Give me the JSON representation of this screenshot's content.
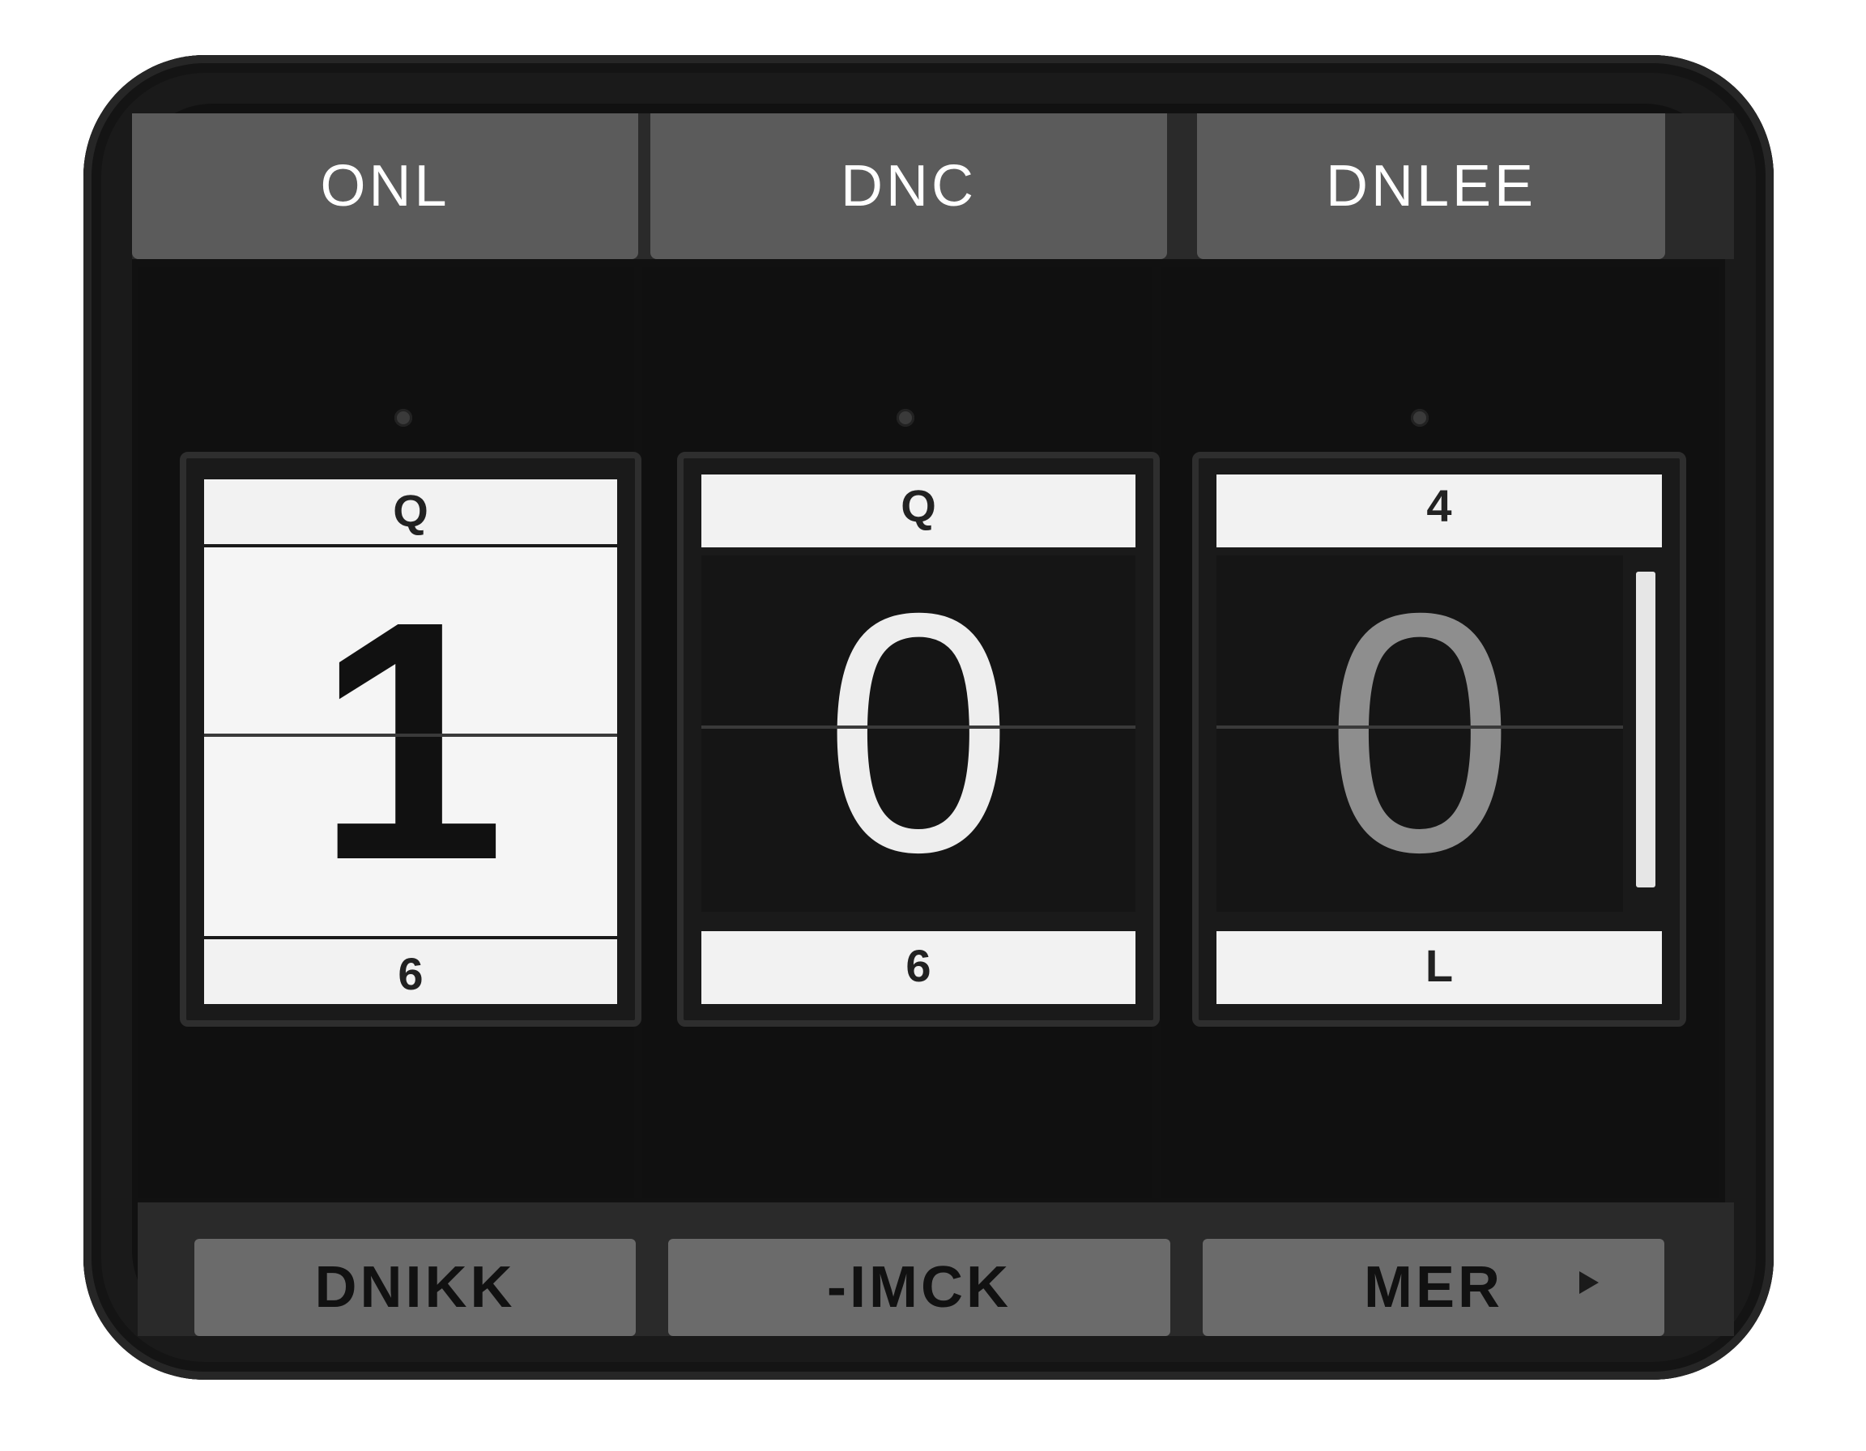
{
  "top_labels": [
    "ONL",
    "DNC",
    "DNLEE"
  ],
  "bottom_labels": [
    "DNIKK",
    "-IMCK",
    "MER"
  ],
  "digits": {
    "hundreds": {
      "value": "1",
      "above": "Q",
      "below": "6"
    },
    "tens": {
      "value": "0",
      "above": "Q",
      "below": "6"
    },
    "ones": {
      "value": "0",
      "above": "4",
      "below": "L"
    }
  },
  "counter_value": 100
}
